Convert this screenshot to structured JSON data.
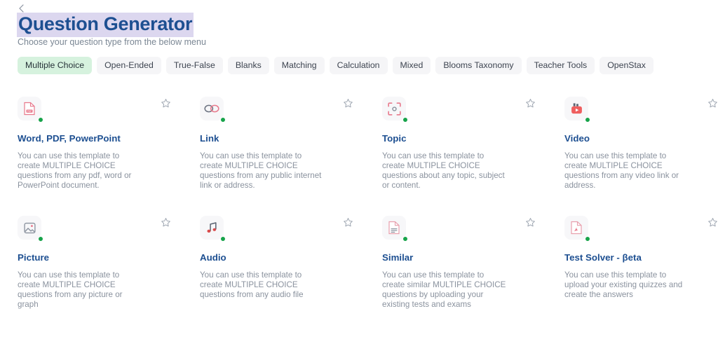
{
  "header": {
    "back_icon": "chevron-left-icon",
    "title": "Question Generator",
    "subtitle": "Choose your question type from the below menu",
    "title_highlight_color": "#dcd7ef",
    "title_color": "#1d4f91"
  },
  "tabs": {
    "active_index": 0,
    "items": [
      {
        "label": "Multiple Choice"
      },
      {
        "label": "Open-Ended"
      },
      {
        "label": "True-False"
      },
      {
        "label": "Blanks"
      },
      {
        "label": "Matching"
      },
      {
        "label": "Calculation"
      },
      {
        "label": "Mixed"
      },
      {
        "label": "Blooms Taxonomy"
      },
      {
        "label": "Teacher Tools"
      },
      {
        "label": "OpenStax"
      }
    ],
    "active_bg": "#d6f2de",
    "inactive_bg": "#f5f5f7"
  },
  "cards": [
    {
      "title": "Word, PDF, PowerPoint",
      "description": "You can use this template to create MULTIPLE CHOICE questions from any pdf, word or PowerPoint document.",
      "icon": "pdf-document-icon",
      "icon_color": "#e8798c",
      "status": "available"
    },
    {
      "title": "Link",
      "description": "You can use this template to create MULTIPLE CHOICE questions from any public internet link or address.",
      "icon": "chain-link-icon",
      "icon_color": "#e8798c",
      "status": "available"
    },
    {
      "title": "Topic",
      "description": "You can use this template to create MULTIPLE CHOICE questions about any topic, subject or content.",
      "icon": "focus-target-icon",
      "icon_color": "#e8798c",
      "status": "available"
    },
    {
      "title": "Video",
      "description": "You can use this template to create MULTIPLE CHOICE questions from any video link or address.",
      "icon": "video-player-icon",
      "icon_color": "#ef5f5f",
      "status": "available"
    },
    {
      "title": "Picture",
      "description": "You can use this template to create MULTIPLE CHOICE questions from any picture or graph",
      "icon": "image-picture-icon",
      "icon_color": "#8a929e",
      "status": "available"
    },
    {
      "title": "Audio",
      "description": "You can use this template to create MULTIPLE CHOICE questions from any audio file",
      "icon": "music-note-icon",
      "icon_color": "#d94a4a",
      "status": "available"
    },
    {
      "title": "Similar",
      "description": "You can use this template to create similar MULTIPLE CHOICE questions by uploading your existing tests and exams",
      "icon": "document-lines-icon",
      "icon_color": "#e8a0ad",
      "status": "available"
    },
    {
      "title": "Test Solver - βeta",
      "description": "You can use this template to upload your existing quizzes and create the answers",
      "icon": "pdf-acrobat-icon",
      "icon_color": "#e8a0ad",
      "status": "available"
    }
  ],
  "favorite_icon": "star-outline-icon",
  "status_dot_color": "#17a34a"
}
